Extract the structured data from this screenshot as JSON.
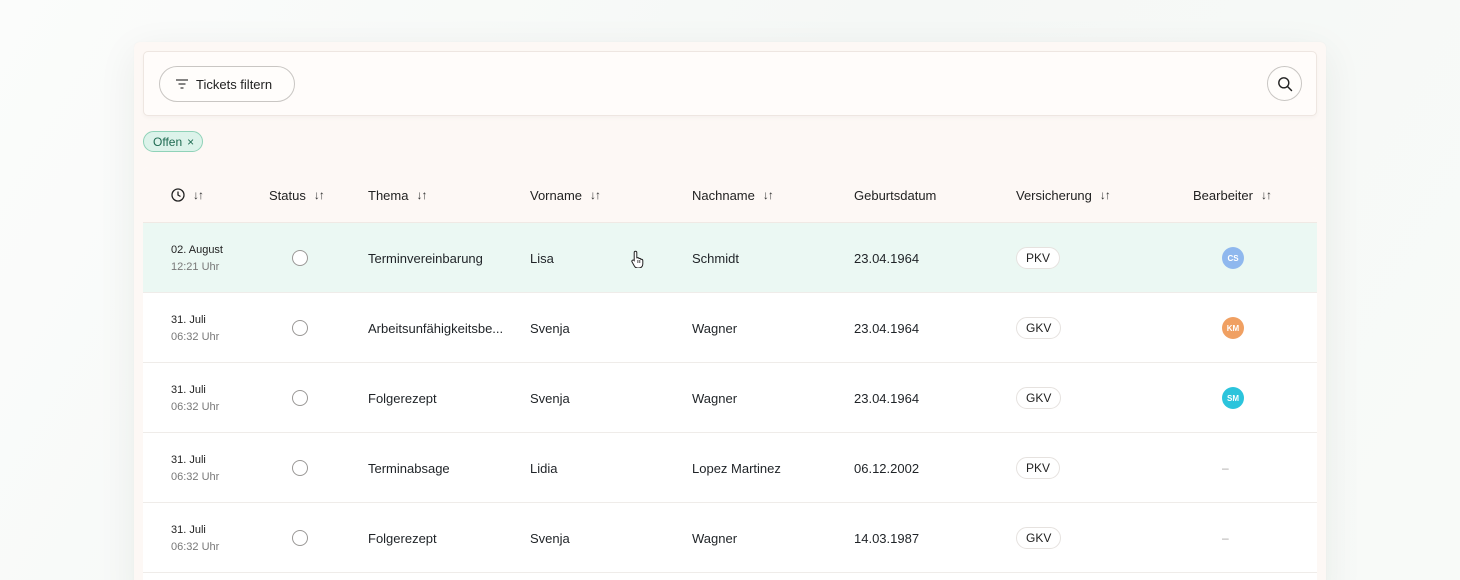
{
  "toolbar": {
    "filter_label": "Tickets filtern",
    "filter_icon": "filter-lines-icon",
    "search_icon": "search-icon"
  },
  "active_filters": [
    {
      "label": "Offen",
      "remove": "×"
    }
  ],
  "table": {
    "columns": {
      "time": {
        "icon": "clock-icon",
        "sort": "↓↑"
      },
      "status": {
        "label": "Status",
        "sort": "↓↑"
      },
      "topic": {
        "label": "Thema",
        "sort": "↓↑"
      },
      "firstname": {
        "label": "Vorname",
        "sort": "↓↑"
      },
      "lastname": {
        "label": "Nachname",
        "sort": "↓↑"
      },
      "birthdate": {
        "label": "Geburtsdatum"
      },
      "insurance": {
        "label": "Versicherung",
        "sort": "↓↑"
      },
      "assignee": {
        "label": "Bearbeiter",
        "sort": "↓↑"
      }
    },
    "rows": [
      {
        "date": "02. August",
        "time": "12:21 Uhr",
        "topic": "Terminvereinbarung",
        "firstname": "Lisa",
        "lastname": "Schmidt",
        "birthdate": "23.04.1964",
        "insurance": "PKV",
        "assignee": "CS",
        "assignee_color": "#8fb8ee",
        "highlighted": true
      },
      {
        "date": "31. Juli",
        "time": "06:32 Uhr",
        "topic": "Arbeitsunfähigkeitsbe...",
        "firstname": "Svenja",
        "lastname": "Wagner",
        "birthdate": "23.04.1964",
        "insurance": "GKV",
        "assignee": "KM",
        "assignee_color": "#f0a062"
      },
      {
        "date": "31. Juli",
        "time": "06:32 Uhr",
        "topic": "Folgerezept",
        "firstname": "Svenja",
        "lastname": "Wagner",
        "birthdate": "23.04.1964",
        "insurance": "GKV",
        "assignee": "SM",
        "assignee_color": "#2bc4dc"
      },
      {
        "date": "31. Juli",
        "time": "06:32 Uhr",
        "topic": "Terminabsage",
        "firstname": "Lidia",
        "lastname": "Lopez Martinez",
        "birthdate": "06.12.2002",
        "insurance": "PKV",
        "assignee": "–",
        "assignee_color": ""
      },
      {
        "date": "31. Juli",
        "time": "06:32 Uhr",
        "topic": "Folgerezept",
        "firstname": "Svenja",
        "lastname": "Wagner",
        "birthdate": "14.03.1987",
        "insurance": "GKV",
        "assignee": "–",
        "assignee_color": ""
      }
    ]
  },
  "colors": {
    "accent_chip_bg": "#dcf3ea",
    "accent_chip_border": "#8fd2b8",
    "row_highlight": "#ebf8f3"
  }
}
